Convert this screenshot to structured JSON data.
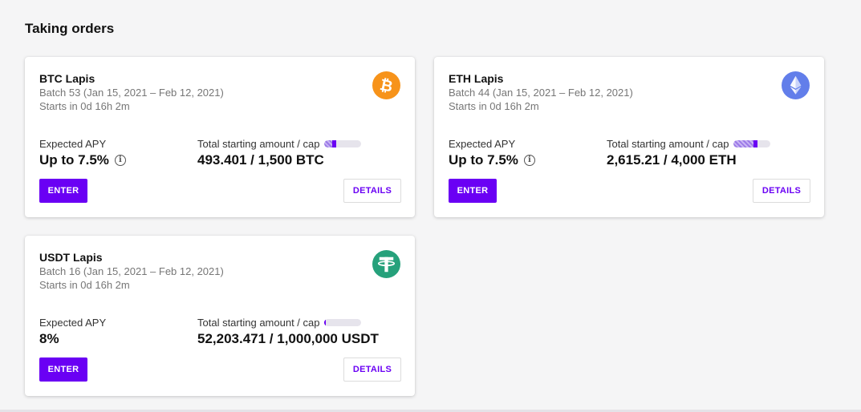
{
  "section": {
    "title": "Taking orders"
  },
  "cards": [
    {
      "name": "BTC Lapis",
      "batch": "Batch 53 (Jan 15, 2021 – Feb 12, 2021)",
      "starts": "Starts in 0d 16h 2m",
      "icon": "bitcoin-icon",
      "icon_color": "#f7931a",
      "apy_label": "Expected APY",
      "apy_value": "Up to 7.5%",
      "apy_info": "i",
      "amount_label": "Total starting amount / cap",
      "amount_value": "493.401 / 1,500 BTC",
      "progress": 0.33,
      "enter_label": "ENTER",
      "details_label": "DETAILS"
    },
    {
      "name": "ETH Lapis",
      "batch": "Batch 44 (Jan 15, 2021 – Feb 12, 2021)",
      "starts": "Starts in 0d 16h 2m",
      "icon": "ethereum-icon",
      "icon_color": "#627eea",
      "apy_label": "Expected APY",
      "apy_value": "Up to 7.5%",
      "apy_info": "i",
      "amount_label": "Total starting amount / cap",
      "amount_value": "2,615.21 / 4,000 ETH",
      "progress": 0.65,
      "enter_label": "ENTER",
      "details_label": "DETAILS"
    },
    {
      "name": "USDT Lapis",
      "batch": "Batch 16 (Jan 15, 2021 – Feb 12, 2021)",
      "starts": "Starts in 0d 16h 2m",
      "icon": "tether-icon",
      "icon_color": "#26a17b",
      "apy_label": "Expected APY",
      "apy_value": "8%",
      "amount_label": "Total starting amount / cap",
      "amount_value": "52,203.471 / 1,000,000 USDT",
      "progress": 0.05,
      "enter_label": "ENTER",
      "details_label": "DETAILS"
    }
  ],
  "colors": {
    "accent": "#6a00f4",
    "background": "#f5f5f6"
  }
}
